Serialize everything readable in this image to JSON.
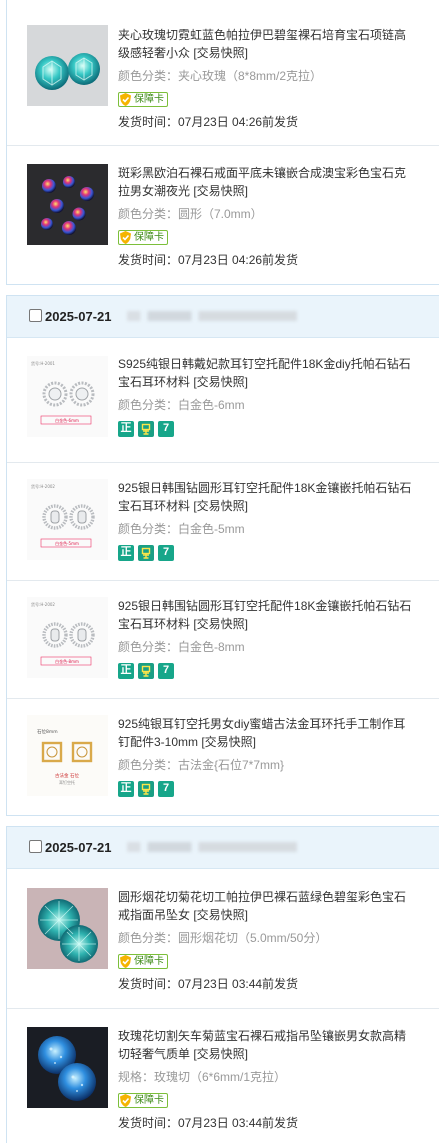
{
  "orders": [
    {
      "date": "",
      "items": [
        {
          "title": "夹心玫瑰切霓虹蓝色帕拉伊巴碧玺裸石培育宝石项链高级感轻奢小众 [交易快照]",
          "sku": "颜色分类：夹心玫瑰（8*8mm/2克拉）",
          "badge": "保障卡",
          "ship": "发货时间：07月23日 04:26前发货",
          "thumb": "teal-rose-cut-stones"
        },
        {
          "title": "斑彩黑欧泊石裸石戒面平底未镶嵌合成澳宝彩色宝石克拉男女潮夜光 [交易快照]",
          "sku": "颜色分类：圆形（7.0mm）",
          "badge": "保障卡",
          "ship": "发货时间：07月23日 04:26前发货",
          "thumb": "black-opal-cabochons"
        }
      ]
    },
    {
      "date": "2025-07-21",
      "items": [
        {
          "title": "S925纯银日韩戴妃款耳钉空托配件18K金diy托帕石钻石宝石耳环材料 [交易快照]",
          "sku": "颜色分类：白金色-6mm",
          "icons": [
            "正",
            "品",
            "7"
          ],
          "thumb": "earring-setting-round",
          "caption": "白金色-6mm"
        },
        {
          "title": "925银日韩围钻圆形耳钉空托配件18K金镶嵌托帕石钻石宝石耳环材料 [交易快照]",
          "sku": "颜色分类：白金色-5mm",
          "icons": [
            "正",
            "品",
            "7"
          ],
          "thumb": "earring-setting-halo",
          "caption": "白金色-5mm"
        },
        {
          "title": "925银日韩围钻圆形耳钉空托配件18K金镶嵌托帕石钻石宝石耳环材料 [交易快照]",
          "sku": "颜色分类：白金色-8mm",
          "icons": [
            "正",
            "品",
            "7"
          ],
          "thumb": "earring-setting-halo",
          "caption": "白金色-8mm"
        },
        {
          "title": "925纯银耳钉空托男女diy蜜蜡古法金耳环托手工制作耳钉配件3-10mm [交易快照]",
          "sku": "颜色分类：古法金{石位7*7mm}",
          "icons": [
            "正",
            "品",
            "7"
          ],
          "thumb": "earring-setting-gold-square",
          "caption": "古法金 石位"
        }
      ]
    },
    {
      "date": "2025-07-21",
      "items": [
        {
          "title": "圆形烟花切菊花切工帕拉伊巴裸石蓝绿色碧玺彩色宝石戒指面吊坠女 [交易快照]",
          "sku": "颜色分类：圆形烟花切（5.0mm/50分）",
          "badge": "保障卡",
          "ship": "发货时间：07月23日 03:44前发货",
          "thumb": "teal-firework-cut-stones"
        },
        {
          "title": "玫瑰花切割矢车菊蓝宝石裸石戒指吊坠镶嵌男女款高精切轻奢气质单 [交易快照]",
          "sku": "规格：玫瑰切（6*6mm/1克拉）",
          "badge": "保障卡",
          "ship": "发货时间：07月23日 03:44前发货",
          "thumb": "blue-rose-cut-stones"
        }
      ]
    }
  ],
  "colors": {
    "header_bg": "#eaf4fb",
    "border": "#cfe3f2",
    "badge_green": "#3d8a16",
    "icon_teal": "#17a68a",
    "muted": "#999999"
  }
}
